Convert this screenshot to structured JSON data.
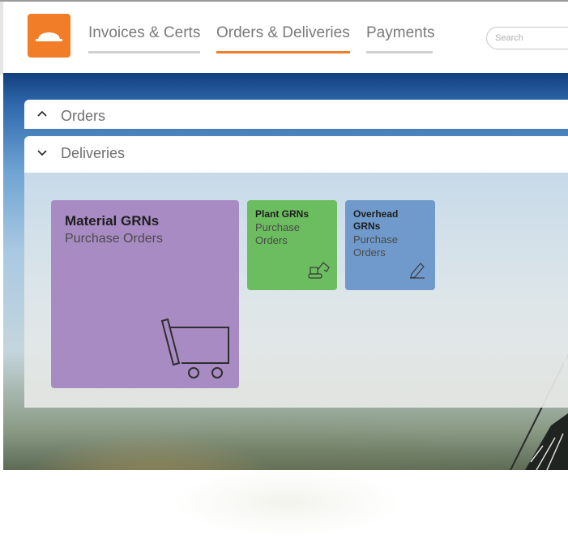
{
  "header": {
    "nav": [
      {
        "label": "Invoices & Certs",
        "active": false
      },
      {
        "label": "Orders & Deliveries",
        "active": true
      },
      {
        "label": "Payments",
        "active": false
      }
    ],
    "search": {
      "placeholder": "Search",
      "value": ""
    }
  },
  "sections": {
    "orders": {
      "title": "Orders",
      "state": "collapsed",
      "chevron": "chevron-up-icon"
    },
    "deliveries": {
      "title": "Deliveries",
      "state": "expanded",
      "chevron": "chevron-down-icon"
    }
  },
  "tiles": [
    {
      "title": "Material GRNs",
      "subtitle": "Purchase Orders",
      "color": "#a98bc4",
      "icon": "shopping-cart-icon"
    },
    {
      "title": "Plant GRNs",
      "subtitle": "Purchase Orders",
      "color": "#6cbd5f",
      "icon": "excavator-icon"
    },
    {
      "title": "Overhead GRNs",
      "subtitle": "Purchase Orders",
      "color": "#6f9acb",
      "icon": "pencil-icon"
    }
  ],
  "colors": {
    "accent": "#ef7d2a",
    "logo": "#f27d28"
  }
}
